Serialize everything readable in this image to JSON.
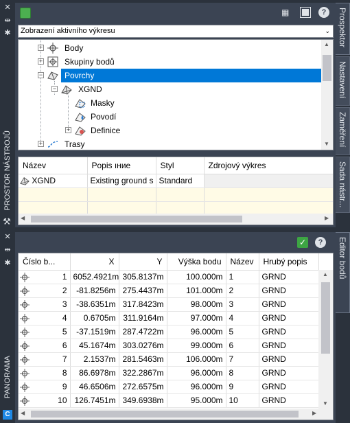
{
  "left_strip": {
    "tool_space_label": "PROSTOR NÁSTROJŮ",
    "panorama_label": "PANORAMA"
  },
  "prospector": {
    "view_dropdown": "Zobrazení aktivního výkresu",
    "tree": [
      {
        "label": "Body",
        "icon": "points-icon"
      },
      {
        "label": "Skupiny bodů",
        "icon": "point-groups-icon"
      },
      {
        "label": "Povrchy",
        "icon": "surfaces-icon"
      },
      {
        "label": "XGND",
        "icon": "surface-icon"
      },
      {
        "label": "Masky",
        "icon": "masks-icon"
      },
      {
        "label": "Povodí",
        "icon": "watersheds-icon"
      },
      {
        "label": "Definice",
        "icon": "definition-icon"
      },
      {
        "label": "Trasy",
        "icon": "alignments-icon"
      }
    ],
    "list_headers": [
      "Název",
      "Popis ıние",
      "Styl",
      "Zdrojový výkres"
    ],
    "list_rows": [
      [
        "XGND",
        "Existing ground s",
        "Standard",
        ""
      ]
    ],
    "tabs": [
      "Prospektor",
      "Nastavení",
      "Zaměření",
      "Sada nástr..."
    ]
  },
  "editor": {
    "headers": [
      "Číslo b...",
      "X",
      "Y",
      "Výška bodu",
      "Název",
      "Hrubý popis"
    ],
    "rows": [
      [
        "1",
        "6052.4921m",
        "305.8137m",
        "100.000m",
        "1",
        "GRND"
      ],
      [
        "2",
        "-81.8256m",
        "275.4437m",
        "101.000m",
        "2",
        "GRND"
      ],
      [
        "3",
        "-38.6351m",
        "317.8423m",
        "98.000m",
        "3",
        "GRND"
      ],
      [
        "4",
        "0.6705m",
        "311.9164m",
        "97.000m",
        "4",
        "GRND"
      ],
      [
        "5",
        "-37.1519m",
        "287.4722m",
        "96.000m",
        "5",
        "GRND"
      ],
      [
        "6",
        "45.1674m",
        "303.0276m",
        "99.000m",
        "6",
        "GRND"
      ],
      [
        "7",
        "2.1537m",
        "281.5463m",
        "106.000m",
        "7",
        "GRND"
      ],
      [
        "8",
        "86.6978m",
        "322.2867m",
        "96.000m",
        "8",
        "GRND"
      ],
      [
        "9",
        "46.6506m",
        "272.6575m",
        "96.000m",
        "9",
        "GRND"
      ],
      [
        "10",
        "126.7451m",
        "349.6938m",
        "95.000m",
        "10",
        "GRND"
      ]
    ],
    "tab": "Editor bodů"
  },
  "colors": {
    "selection": "#0078d7",
    "empty_row": "#fffbe6",
    "panel_bg": "#3b4453",
    "app_bg": "#2b323c"
  }
}
